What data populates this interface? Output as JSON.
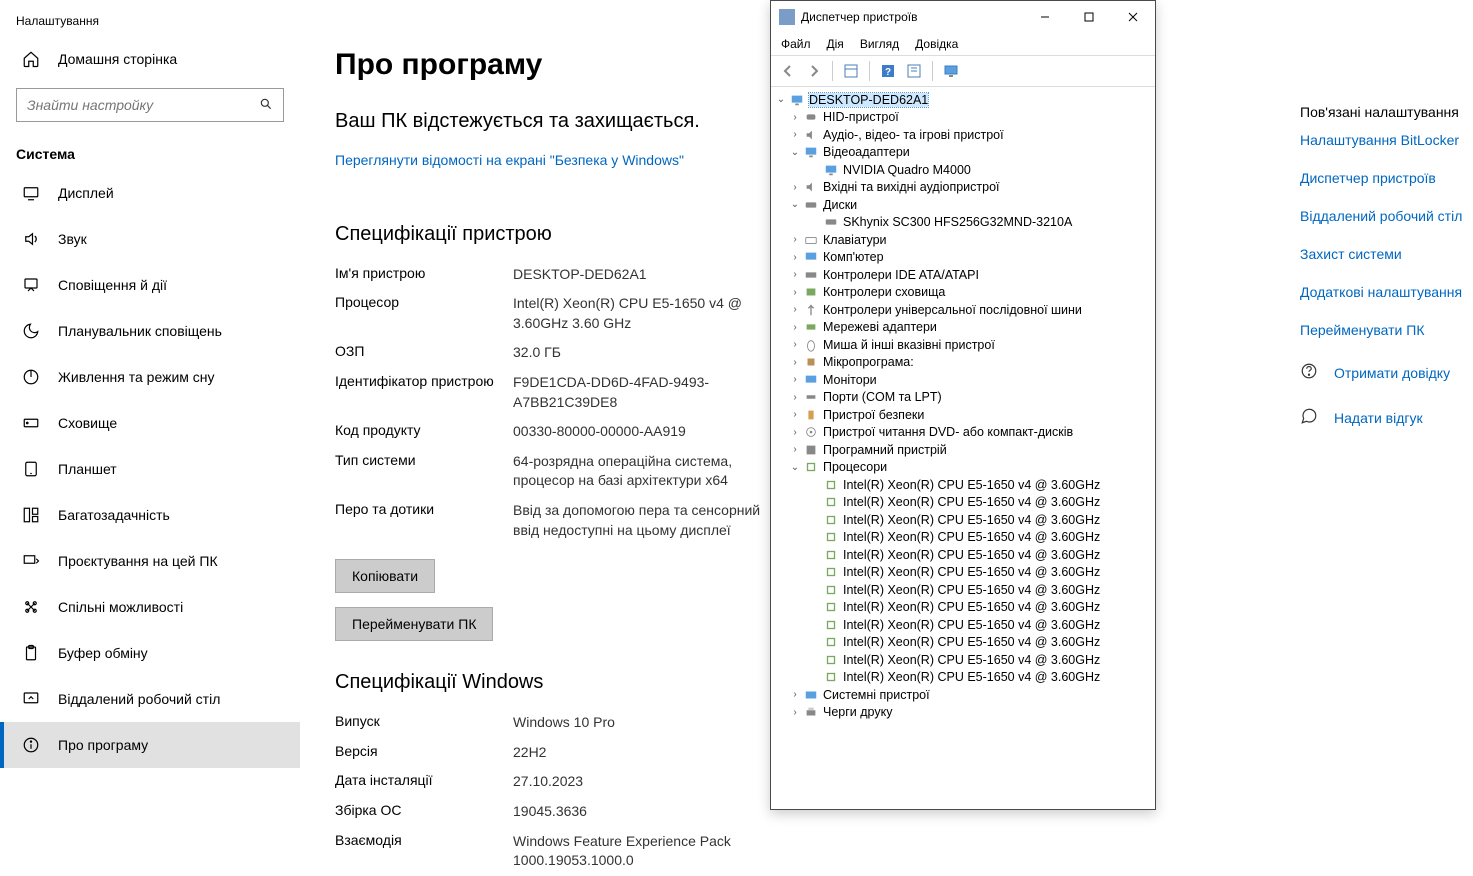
{
  "settings": {
    "app_title": "Налаштування",
    "home": "Домашня сторінка",
    "search_placeholder": "Знайти настройку",
    "category": "Система",
    "nav": {
      "display": "Дисплей",
      "sound": "Звук",
      "notifications": "Сповіщення й дії",
      "focus": "Планувальник сповіщень",
      "power": "Живлення та режим сну",
      "storage": "Сховище",
      "tablet": "Планшет",
      "multitask": "Багатозадачність",
      "projecting": "Проєктування на цей ПК",
      "shared": "Спільні можливості",
      "clipboard": "Буфер обміну",
      "remote": "Віддалений робочий стіл",
      "about": "Про програму"
    }
  },
  "about": {
    "title": "Про програму",
    "security_heading": "Ваш ПК відстежується та захищається.",
    "security_link": "Переглянути відомості на екрані \"Безпека у Windows\"",
    "device_spec_heading": "Специфікації пристрою",
    "device_name_label": "Ім'я пристрою",
    "device_name_value": "DESKTOP-DED62A1",
    "processor_label": "Процесор",
    "processor_value": "Intel(R) Xeon(R) CPU E5-1650 v4 @ 3.60GHz   3.60 GHz",
    "ram_label": "ОЗП",
    "ram_value": "32.0 ГБ",
    "device_id_label": "Ідентифікатор пристрою",
    "device_id_value": "F9DE1CDA-DD6D-4FAD-9493-A7BB21C39DE8",
    "product_id_label": "Код продукту",
    "product_id_value": "00330-80000-00000-AA919",
    "system_type_label": "Тип системи",
    "system_type_value": "64-розрядна операційна система, процесор на базі архітектури x64",
    "pen_label": "Перо та дотики",
    "pen_value": "Ввід за допомогою пера та сенсорний ввід недоступні на цьому дисплеї",
    "copy_btn": "Копіювати",
    "rename_btn": "Перейменувати ПК",
    "windows_spec_heading": "Специфікації Windows",
    "edition_label": "Випуск",
    "edition_value": "Windows 10 Pro",
    "version_label": "Версія",
    "version_value": "22H2",
    "install_date_label": "Дата інсталяції",
    "install_date_value": "27.10.2023",
    "build_label": "Збірка ОС",
    "build_value": "19045.3636",
    "experience_label": "Взаємодія",
    "experience_value": "Windows Feature Experience Pack 1000.19053.1000.0"
  },
  "related": {
    "heading": "Пов'язані налаштування",
    "bitlocker": "Налаштування BitLocker",
    "devmgr": "Диспетчер пристроїв",
    "remote": "Віддалений робочий стіл",
    "protection": "Захист системи",
    "advanced": "Додаткові налаштування",
    "rename": "Перейменувати ПК",
    "get_help": "Отримати довідку",
    "feedback": "Надати відгук"
  },
  "devmgr": {
    "title": "Диспетчер пристроїв",
    "menu": {
      "file": "Файл",
      "action": "Дія",
      "view": "Вигляд",
      "help": "Довідка"
    },
    "root": "DESKTOP-DED62A1",
    "cat": {
      "hid": "HID-пристрої",
      "audio": "Аудіо-, відео- та ігрові пристрої",
      "video": "Відеоадаптери",
      "gpu": "NVIDIA Quadro M4000",
      "audioio": "Вхідні та вихідні аудіопристрої",
      "disks": "Диски",
      "disk1": "SKhynix SC300 HFS256G32MND-3210A",
      "keyboards": "Клавіатури",
      "computer": "Комп'ютер",
      "ide": "Контролери IDE ATA/ATAPI",
      "storagectrl": "Контролери сховища",
      "usb": "Контролери універсальної послідовної шини",
      "network": "Мережеві адаптери",
      "mice": "Миша й інші вказівні пристрої",
      "firmware": "Мікропрограма:",
      "monitors": "Монітори",
      "ports": "Порти (COM та LPT)",
      "security": "Пристрої безпеки",
      "dvd": "Пристрої читання DVD- або компакт-дисків",
      "software": "Програмний пристрій",
      "processors": "Процесори",
      "cpu": "Intel(R) Xeon(R) CPU E5-1650 v4 @ 3.60GHz",
      "system": "Системні пристрої",
      "printqueue": "Черги друку"
    }
  }
}
